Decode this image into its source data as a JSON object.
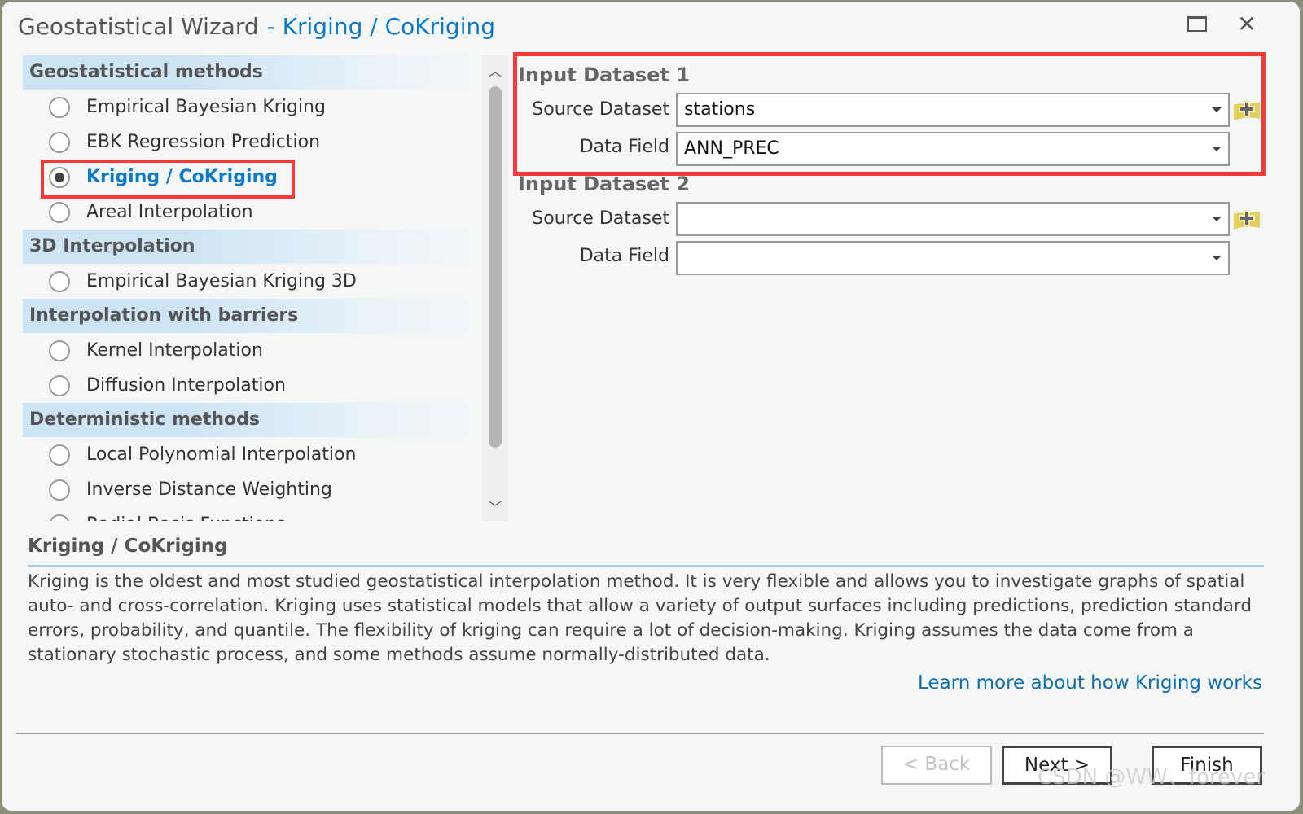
{
  "window": {
    "title": "Geostatistical Wizard",
    "subtitle": "- Kriging / CoKriging"
  },
  "methods": [
    {
      "header": "Geostatistical methods",
      "items": [
        {
          "label": "Empirical Bayesian Kriging",
          "selected": false
        },
        {
          "label": "EBK Regression Prediction",
          "selected": false
        },
        {
          "label": "Kriging / CoKriging",
          "selected": true
        },
        {
          "label": "Areal Interpolation",
          "selected": false
        }
      ]
    },
    {
      "header": "3D Interpolation",
      "items": [
        {
          "label": "Empirical Bayesian Kriging 3D",
          "selected": false
        }
      ]
    },
    {
      "header": "Interpolation with barriers",
      "items": [
        {
          "label": "Kernel Interpolation",
          "selected": false
        },
        {
          "label": "Diffusion Interpolation",
          "selected": false
        }
      ]
    },
    {
      "header": "Deterministic methods",
      "items": [
        {
          "label": "Local Polynomial Interpolation",
          "selected": false
        },
        {
          "label": "Inverse Distance Weighting",
          "selected": false
        },
        {
          "label": "Radial Basis Functions",
          "selected": false
        }
      ]
    }
  ],
  "input1": {
    "title": "Input Dataset 1",
    "source_label": "Source Dataset",
    "source_value": "stations",
    "field_label": "Data Field",
    "field_value": "ANN_PREC"
  },
  "input2": {
    "title": "Input Dataset 2",
    "source_label": "Source Dataset",
    "source_value": "",
    "field_label": "Data Field",
    "field_value": ""
  },
  "description": {
    "title": "Kriging / CoKriging",
    "text": "Kriging is the oldest and most studied geostatistical interpolation method. It is very flexible and allows you to investigate graphs of spatial auto- and cross-correlation. Kriging uses statistical models that allow a variety of output surfaces including predictions, prediction standard errors, probability, and quantile. The flexibility of kriging can require a lot of decision-making. Kriging assumes the data come from a stationary stochastic process, and some methods assume normally-distributed data.",
    "link": "Learn more about how Kriging works"
  },
  "buttons": {
    "back": "< Back",
    "next": "Next >",
    "finish": "Finish"
  },
  "watermark": "CSDN @WW、forever",
  "colors": {
    "accent": "#0e7acb",
    "highlight": "#f53838",
    "header_bg": "#cde4f4"
  }
}
